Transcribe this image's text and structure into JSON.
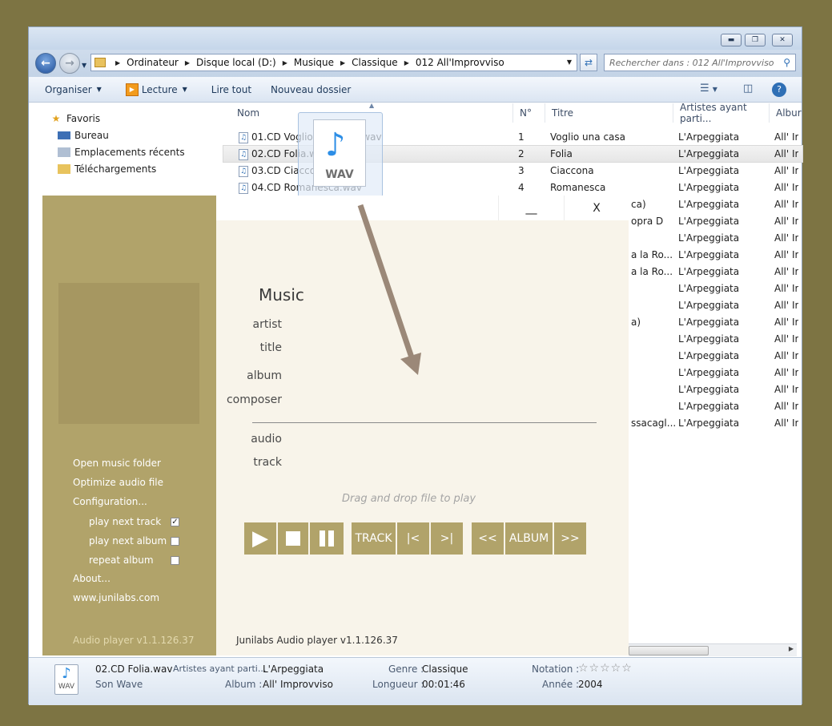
{
  "explorer": {
    "breadcrumb": [
      "Ordinateur",
      "Disque local (D:)",
      "Musique",
      "Classique",
      "012 All'Improvviso"
    ],
    "search_placeholder": "Rechercher dans : 012 All'Improvviso",
    "toolbar": {
      "organize": "Organiser",
      "play": "Lecture",
      "play_all": "Lire tout",
      "new_folder": "Nouveau dossier"
    },
    "nav": {
      "favorites": "Favoris",
      "items": [
        "Bureau",
        "Emplacements récents",
        "Téléchargements"
      ]
    },
    "columns": [
      "Nom",
      "N°",
      "Titre",
      "Artistes ayant parti...",
      "Albur"
    ],
    "rows": [
      {
        "name": "01.CD Voglio una casa.wav",
        "num": "1",
        "title": "Voglio una casa",
        "artist": "L'Arpeggiata",
        "album": "All' Ir"
      },
      {
        "name": "02.CD Folia.wav",
        "num": "2",
        "title": "Folia",
        "artist": "L'Arpeggiata",
        "album": "All' Ir"
      },
      {
        "name": "03.CD Ciaccona.wav",
        "num": "3",
        "title": "Ciaccona",
        "artist": "L'Arpeggiata",
        "album": "All' Ir"
      },
      {
        "name": "04.CD Romanesca.wav",
        "num": "4",
        "title": "Romanesca",
        "artist": "L'Arpeggiata",
        "album": "All' Ir"
      }
    ],
    "hidden_rows": [
      {
        "title_tail": "ca)",
        "artist": "L'Arpeggiata",
        "album": "All' Ir"
      },
      {
        "title_tail": "opra D",
        "artist": "L'Arpeggiata",
        "album": "All' Ir"
      },
      {
        "title_tail": "",
        "artist": "L'Arpeggiata",
        "album": "All' Ir"
      },
      {
        "title_tail": "a la Ro...",
        "artist": "L'Arpeggiata",
        "album": "All' Ir"
      },
      {
        "title_tail": "a la Ro...",
        "artist": "L'Arpeggiata",
        "album": "All' Ir"
      },
      {
        "title_tail": "",
        "artist": "L'Arpeggiata",
        "album": "All' Ir"
      },
      {
        "title_tail": "",
        "artist": "L'Arpeggiata",
        "album": "All' Ir"
      },
      {
        "title_tail": "a)",
        "artist": "L'Arpeggiata",
        "album": "All' Ir"
      },
      {
        "title_tail": "",
        "artist": "L'Arpeggiata",
        "album": "All' Ir"
      },
      {
        "title_tail": "",
        "artist": "L'Arpeggiata",
        "album": "All' Ir"
      },
      {
        "title_tail": "",
        "artist": "L'Arpeggiata",
        "album": "All' Ir"
      },
      {
        "title_tail": "",
        "artist": "L'Arpeggiata",
        "album": "All' Ir"
      },
      {
        "title_tail": "",
        "artist": "L'Arpeggiata",
        "album": "All' Ir"
      },
      {
        "title_tail": "ssacagl...",
        "artist": "L'Arpeggiata",
        "album": "All' Ir"
      }
    ],
    "details": {
      "filename": "02.CD Folia.wav",
      "type": "Son Wave",
      "artist_label": "Artistes ayant parti...",
      "artist_value": "L'Arpeggiata",
      "album_label": "Album :",
      "album_value": "All' Improvviso",
      "genre_label": "Genre :",
      "genre_value": "Classique",
      "length_label": "Longueur :",
      "length_value": "00:01:46",
      "rating_label": "Notation :",
      "year_label": "Année :",
      "year_value": "2004",
      "file_badge": "WAV"
    },
    "drag_badge": "WAV"
  },
  "player": {
    "side_links": [
      "Open music folder",
      "Optimize audio file",
      "Configuration..."
    ],
    "options": [
      {
        "label": "play next track",
        "checked": true
      },
      {
        "label": "play next album",
        "checked": false
      },
      {
        "label": "repeat album",
        "checked": false
      }
    ],
    "about": "About...",
    "website": "www.junilabs.com",
    "side_version": "Audio player v1.1.126.37",
    "minimize": "__",
    "close": "X",
    "music_heading": "Music",
    "labels": {
      "artist": "artist",
      "title": "title",
      "album": "album",
      "composer": "composer",
      "audio": "audio",
      "track": "track"
    },
    "drop_message": "Drag and drop file to play",
    "controls": {
      "track": "TRACK",
      "prev_track": "|<",
      "next_track": ">|",
      "prev_album": "<<",
      "album": "ALBUM",
      "next_album": ">>"
    },
    "version": "Junilabs Audio player v1.1.126.37"
  }
}
